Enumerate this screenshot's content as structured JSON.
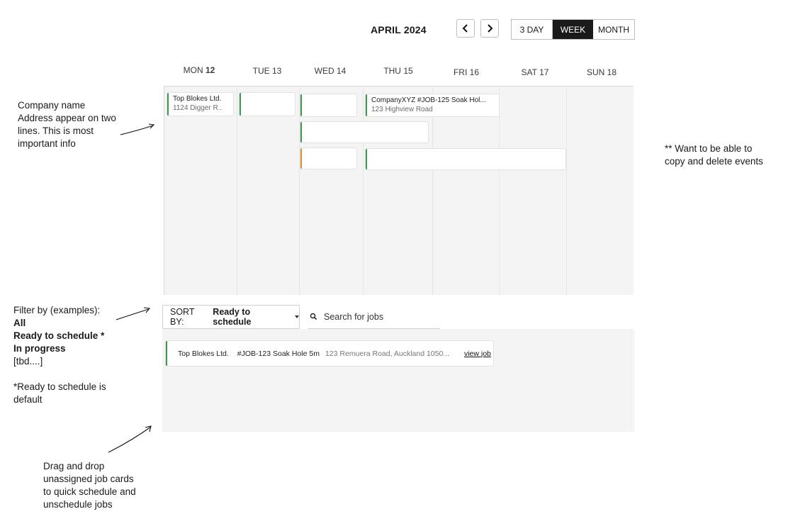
{
  "header": {
    "month_label": "APRIL 2024",
    "views": [
      "3 DAY",
      "WEEK",
      "MONTH"
    ],
    "active_view": "WEEK"
  },
  "days": [
    {
      "dow": "MON",
      "num": "12"
    },
    {
      "dow": "TUE",
      "num": "13"
    },
    {
      "dow": "WED",
      "num": "14"
    },
    {
      "dow": "THU",
      "num": "15"
    },
    {
      "dow": "FRI",
      "num": "16"
    },
    {
      "dow": "SAT",
      "num": "17"
    },
    {
      "dow": "SUN",
      "num": "18"
    }
  ],
  "events": [
    {
      "title": "Top Blokes Ltd.",
      "subtitle": "1124 Digger R..",
      "color": "#3a9a4a"
    },
    {
      "title": "",
      "subtitle": "",
      "color": "#3a9a4a"
    },
    {
      "title": "",
      "subtitle": "",
      "color": "#3a9a4a"
    },
    {
      "title": "CompanyXYZ #JOB-125 Soak Hol...",
      "subtitle": "123 Highview Road",
      "color": "#3a9a4a"
    },
    {
      "title": "",
      "subtitle": "",
      "color": "#3a9a4a"
    },
    {
      "title": "",
      "subtitle": "",
      "color": "#e0902a"
    },
    {
      "title": "",
      "subtitle": "",
      "color": "#3a9a4a"
    }
  ],
  "annotations": {
    "company": [
      "Company name",
      "Address appear on two",
      "lines. This is most",
      "important info"
    ],
    "copy_delete": [
      "** Want to be able to",
      "copy and delete events"
    ],
    "filter_intro": "Filter by (examples):",
    "filter_options": [
      "All",
      "Ready to schedule *",
      "In progress"
    ],
    "filter_tbd": "[tbd....]",
    "filter_default": [
      "*Ready to schedule is",
      "default"
    ],
    "drag": [
      "Drag and drop",
      "unassigned job cards",
      "to quick schedule and",
      "unschedule jobs"
    ]
  },
  "sort": {
    "label": "SORT BY:",
    "value": "Ready to schedule"
  },
  "search": {
    "placeholder": "Search for jobs"
  },
  "jobs": [
    {
      "company": "Top Blokes Ltd.",
      "job": "#JOB-123 Soak Hole 5m",
      "address": "123 Remuera Road, Auckland 1050...",
      "action": "view job"
    }
  ],
  "colors": {
    "accent_green": "#3a9a4a",
    "accent_orange": "#e0902a",
    "active_view_bg": "#1a1a1a"
  }
}
